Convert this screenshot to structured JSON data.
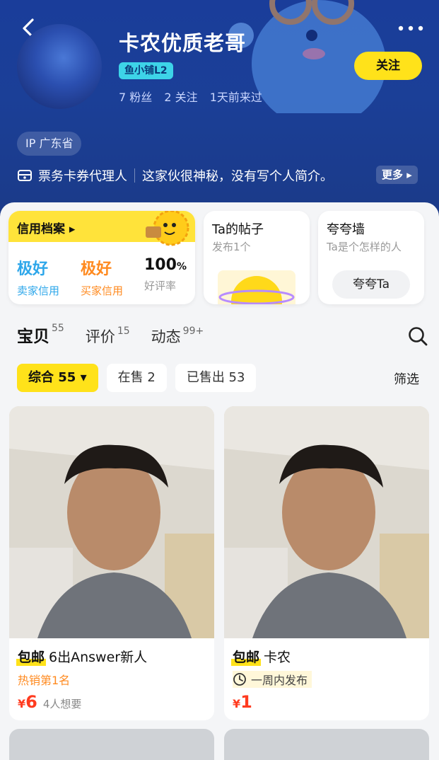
{
  "header": {
    "username": "卡农优质老哥",
    "level_badge": "鱼小铺L2",
    "followers": "7 粉丝",
    "following": "2 关注",
    "last_seen": "1天前来过",
    "follow_label": "关注",
    "ip_location": "IP 广东省",
    "role": "票务卡券代理人",
    "bio": "这家伙很神秘，没有写个人简介。",
    "more_label": "更多"
  },
  "credit": {
    "title": "信用档案",
    "seller_value": "极好",
    "seller_label": "卖家信用",
    "buyer_value": "极好",
    "buyer_label": "买家信用",
    "rating_value": "100",
    "rating_unit": "%",
    "rating_label": "好评率"
  },
  "posts": {
    "title": "Ta的帖子",
    "sub": "发布1个"
  },
  "praise_wall": {
    "title": "夸夸墙",
    "sub": "Ta是个怎样的人",
    "button": "夸夸Ta"
  },
  "tabs": [
    {
      "label": "宝贝",
      "count": "55"
    },
    {
      "label": "评价",
      "count": "15"
    },
    {
      "label": "动态",
      "count": "99+"
    }
  ],
  "filters": {
    "chips": [
      "综合 55",
      "在售 2",
      "已售出 53"
    ],
    "right": "筛选"
  },
  "products": [
    {
      "tag": "包邮",
      "title": "6出Answer新人",
      "sub": "热销第1名",
      "yen": "¥",
      "price": "6",
      "want": "4人想要"
    },
    {
      "tag": "包邮",
      "title": "卡农",
      "sub": "一周内发布",
      "yen": "¥",
      "price": "1",
      "want": ""
    }
  ],
  "colors": {
    "accent": "#ffe21a",
    "header_bg": "#1b3f97",
    "price": "#ff3b1f",
    "seller_credit": "#2ea7ea",
    "buyer_credit": "#ff8a1f"
  }
}
